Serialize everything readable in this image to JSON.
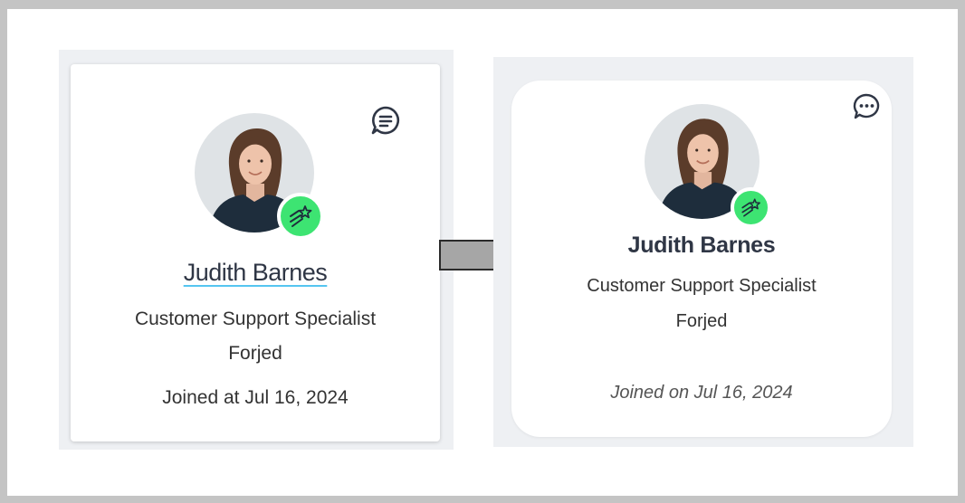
{
  "before_card": {
    "name": "Judith Barnes",
    "title": "Customer Support Specialist",
    "company": "Forjed",
    "joined": "Joined at Jul 16, 2024",
    "badge_icon": "shooting-star-icon",
    "action_icon": "message-icon",
    "badge_color": "#3de472",
    "name_underline_color": "#55c5f0"
  },
  "after_card": {
    "name": "Judith Barnes",
    "title": "Customer Support Specialist",
    "company": "Forjed",
    "joined": "Joined on Jul 16, 2024",
    "badge_icon": "shooting-star-icon",
    "action_icon": "chat-bubble-icon",
    "badge_color": "#3de472"
  },
  "transition_icon": "right-arrow-icon",
  "colors": {
    "frame_border": "#c4c4c4",
    "panel_background": "#eef0f3",
    "arrow_fill": "#a6a6a6"
  }
}
